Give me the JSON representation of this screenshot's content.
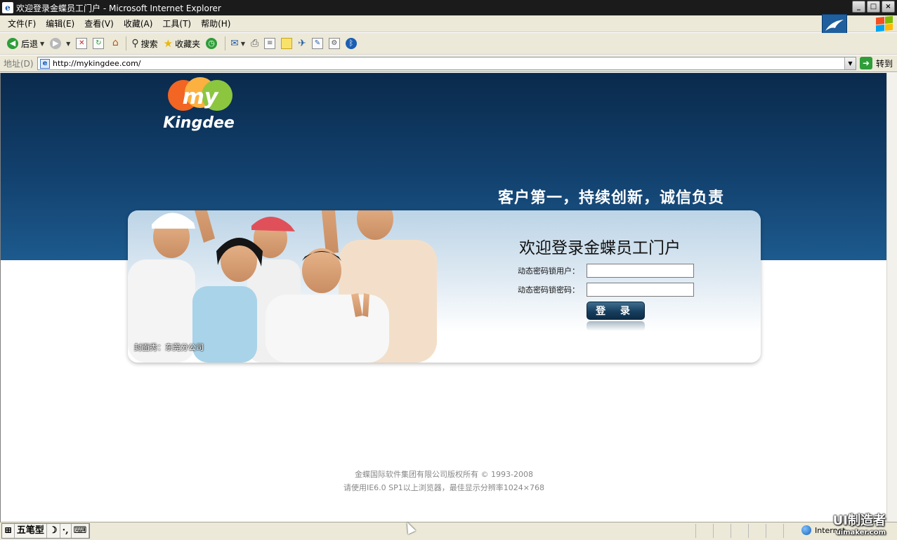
{
  "window": {
    "title": "欢迎登录金蝶员工门户 - Microsoft Internet Explorer"
  },
  "menu": [
    "文件(F)",
    "编辑(E)",
    "查看(V)",
    "收藏(A)",
    "工具(T)",
    "帮助(H)"
  ],
  "toolbar": {
    "back_label": "后退",
    "search_label": "搜索",
    "favorites_label": "收藏夹"
  },
  "address": {
    "label": "地址(D)",
    "url": "http://mykingdee.com/",
    "go_label": "转到"
  },
  "page": {
    "logo_top": "my",
    "logo_bottom": "Kingdee",
    "slogan": "客户第一，持续创新，诚信负责",
    "photo_caption": "封面秀：东莞分公司",
    "login": {
      "title": "欢迎登录金蝶员工门户",
      "user_label": "动态密码锁用户：",
      "user_value": "",
      "password_label": "动态密码锁密码：",
      "password_value": "",
      "submit_label": "登 录"
    },
    "footer": {
      "copyright": "金蝶国际软件集团有限公司版权所有 © 1993-2008",
      "browser_note": "请使用IE6.0 SP1以上浏览器，最佳显示分辨率1024×768"
    }
  },
  "statusbar": {
    "ime_mode": "五笔型",
    "zone": "Internet"
  },
  "watermark": {
    "main": "UI制造者",
    "sub": "uimaker.com"
  },
  "colors": {
    "banner_dark": "#0a2a4c",
    "banner_light": "#1d5a8e",
    "login_button": "#173e5e",
    "logo_orange": "#f26522",
    "logo_green": "#8cc63f"
  },
  "icons": [
    "back-icon",
    "forward-icon",
    "stop-icon",
    "refresh-icon",
    "home-icon",
    "search-icon",
    "favorites-icon",
    "history-icon",
    "mail-icon",
    "print-icon",
    "edit-icon",
    "notes-icon",
    "messenger-icon",
    "research-icon",
    "bluetooth-icon",
    "go-icon",
    "globe-icon"
  ]
}
